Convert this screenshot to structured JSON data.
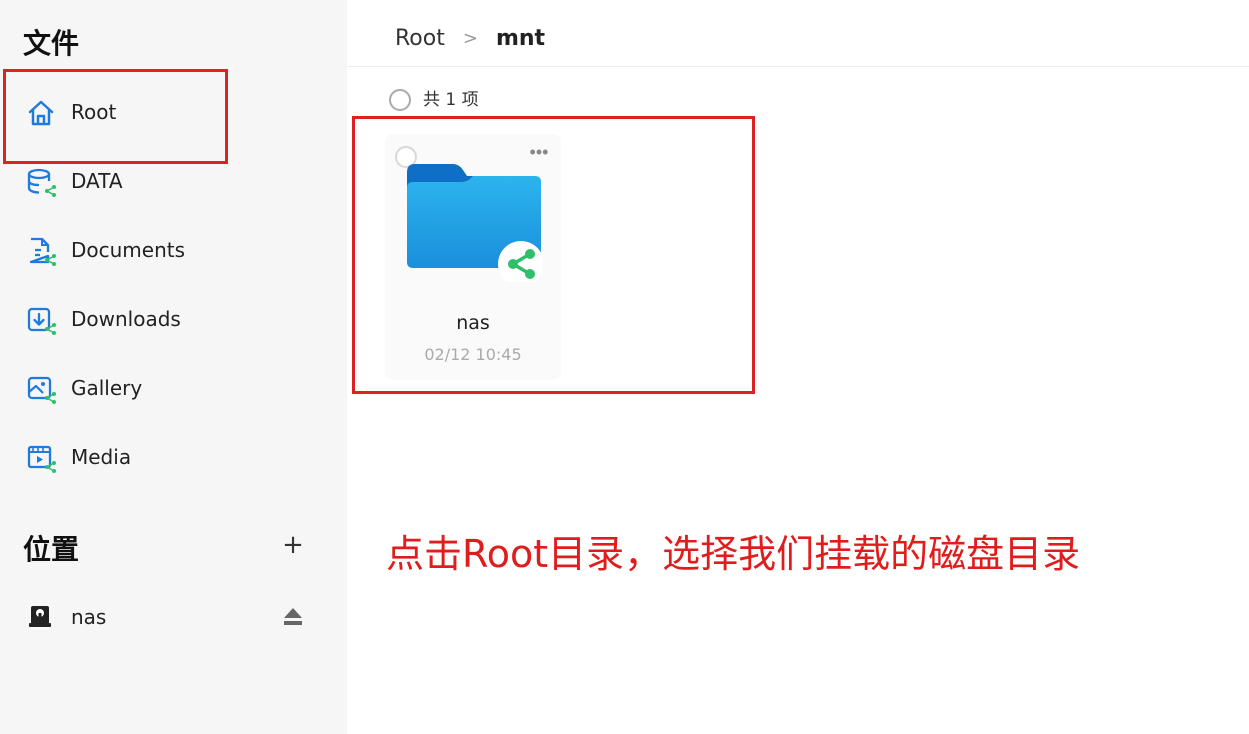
{
  "sidebar": {
    "files_title": "文件",
    "items": [
      {
        "label": "Root",
        "icon": "home-icon"
      },
      {
        "label": "DATA",
        "icon": "shared-database-icon"
      },
      {
        "label": "Documents",
        "icon": "shared-document-icon"
      },
      {
        "label": "Downloads",
        "icon": "shared-download-icon"
      },
      {
        "label": "Gallery",
        "icon": "shared-gallery-icon"
      },
      {
        "label": "Media",
        "icon": "shared-media-icon"
      }
    ],
    "locations_title": "位置",
    "add_label": "+",
    "locations": [
      {
        "label": "nas",
        "icon": "nas-drive-icon"
      }
    ]
  },
  "breadcrumb": {
    "root": "Root",
    "separator": ">",
    "current": "mnt"
  },
  "list": {
    "count_label": "共 1 项",
    "items": [
      {
        "name": "nas",
        "date": "02/12 10:45",
        "more_label": "•••"
      }
    ]
  },
  "annotation": {
    "text": "点击Root目录，选择我们挂载的磁盘目录",
    "color": "#e11c1c"
  },
  "colors": {
    "accent_blue": "#1f7ae0",
    "share_green": "#2ebf6a",
    "folder_blue": "#2aa6ea",
    "highlight_red": "#dd2222"
  }
}
